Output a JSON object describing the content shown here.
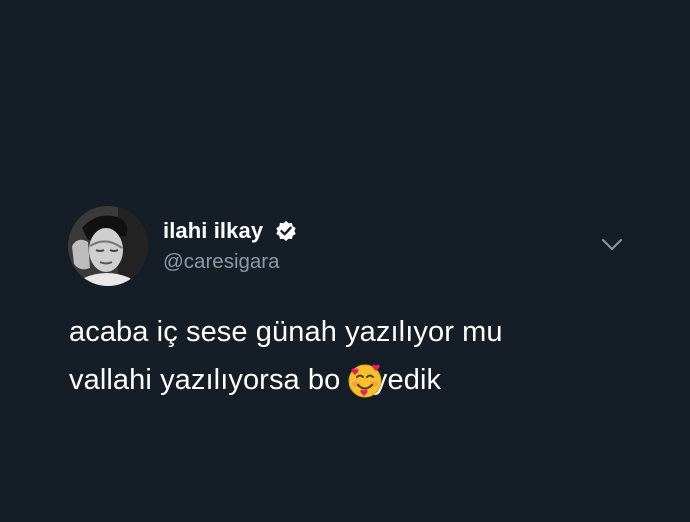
{
  "tweet": {
    "author": {
      "display_name": "ilahi ilkay",
      "handle": "@caresigara",
      "verified": true,
      "avatar_icon": "profile-photo"
    },
    "menu_icon": "chevron-down-icon",
    "text_lines": [
      "acaba iç sese günah yazılıyor mu",
      "vallahi yazılıyorsa bo    u yedik"
    ],
    "emoji": "smiling-face-with-hearts"
  },
  "colors": {
    "background": "#151d27",
    "text": "#ffffff",
    "secondary_text": "#8b98a5"
  }
}
